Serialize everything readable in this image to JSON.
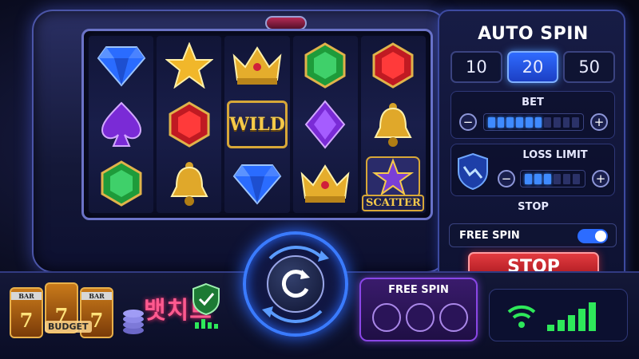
{
  "auto_spin": {
    "title": "AUTO SPIN",
    "counts": [
      "10",
      "20",
      "50"
    ],
    "selected_count": "20"
  },
  "bet": {
    "label": "BET",
    "level": 0.6,
    "minus": "−",
    "plus": "+"
  },
  "loss_limit": {
    "label": "LOSS LIMIT",
    "level": 0.5,
    "minus": "−",
    "plus": "+"
  },
  "stop_section": {
    "label": "STOP",
    "toggle_label": "FREE SPIN",
    "toggle_on": true
  },
  "stop_button": {
    "label": "STOP"
  },
  "reels": {
    "wild_label": "WILD",
    "scatter_label": "SCATTER",
    "grid": [
      [
        "blue-diamond",
        "purple-spade",
        "green-gem"
      ],
      [
        "gold-star",
        "red-gem",
        "gold-bell"
      ],
      [
        "gold-crown",
        "wild",
        "blue-diamond"
      ],
      [
        "green-gem",
        "purple-diamond",
        "gold-crown"
      ],
      [
        "red-gem",
        "gold-bell",
        "scatter-star"
      ]
    ]
  },
  "free_spin_box": {
    "label": "FREE SPIN",
    "slots": 3
  },
  "left_strip": {
    "reel_digits": [
      "7",
      "7",
      "7"
    ],
    "bar_label": "BAR",
    "budget_label": "BUDGET",
    "brand_text": "뱃치트"
  },
  "colors": {
    "accent_blue": "#2f6bff",
    "stop_red": "#e33b40",
    "gold": "#f5c94a",
    "free_spin_purple": "#8a46e6",
    "signal_green": "#2ee85a"
  }
}
